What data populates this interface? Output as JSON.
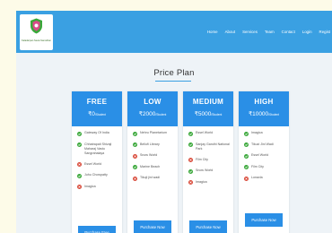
{
  "nav": {
    "logo_text": "Kaladarpan Sewa Samsthan",
    "links": [
      "Home",
      "About",
      "Services",
      "Team",
      "Contact",
      "Login",
      "Regist"
    ]
  },
  "title": "Price Plan",
  "colors": {
    "accent": "#2a8fe6",
    "navbar": "#3aa0e2",
    "check": "#3aa83a",
    "cross": "#d94a3a"
  },
  "plans": [
    {
      "name": "FREE",
      "price": "₹0",
      "price_suffix": "/Student",
      "button": "Purchase Free",
      "features": [
        {
          "text": "Gateway Of India",
          "included": true
        },
        {
          "text": "Chhatrapati Shivaji Maharaj Vastu Sangrahalaya",
          "included": true
        },
        {
          "text": "Essel World",
          "included": false
        },
        {
          "text": "Juhu Chowpatty",
          "included": true
        },
        {
          "text": "Imagica",
          "included": false
        }
      ]
    },
    {
      "name": "LOW",
      "price": "₹2000",
      "price_suffix": "/Student",
      "button": "Purchase Now",
      "features": [
        {
          "text": "Nehru Planetarium",
          "included": true
        },
        {
          "text": "Bellofi Library",
          "included": true
        },
        {
          "text": "Snow World",
          "included": false
        },
        {
          "text": "Marine Beach",
          "included": true
        },
        {
          "text": "Tikuji jini wadi",
          "included": false
        }
      ]
    },
    {
      "name": "MEDIUM",
      "price": "₹5000",
      "price_suffix": "/Student",
      "button": "Purchase Now",
      "features": [
        {
          "text": "Essel World",
          "included": true
        },
        {
          "text": "Sanjay Gandhi National Park",
          "included": true
        },
        {
          "text": "Film City",
          "included": false
        },
        {
          "text": "Snow World",
          "included": true
        },
        {
          "text": "Imagica",
          "included": false
        }
      ]
    },
    {
      "name": "HIGH",
      "price": "₹10000",
      "price_suffix": "/Student",
      "button": "Purchase Now",
      "features": [
        {
          "text": "Imagica",
          "included": true
        },
        {
          "text": "Tikuzi Jini Wadi",
          "included": true
        },
        {
          "text": "Essel World",
          "included": true
        },
        {
          "text": "Film City",
          "included": true
        },
        {
          "text": "Lonavla",
          "included": false
        }
      ]
    }
  ]
}
